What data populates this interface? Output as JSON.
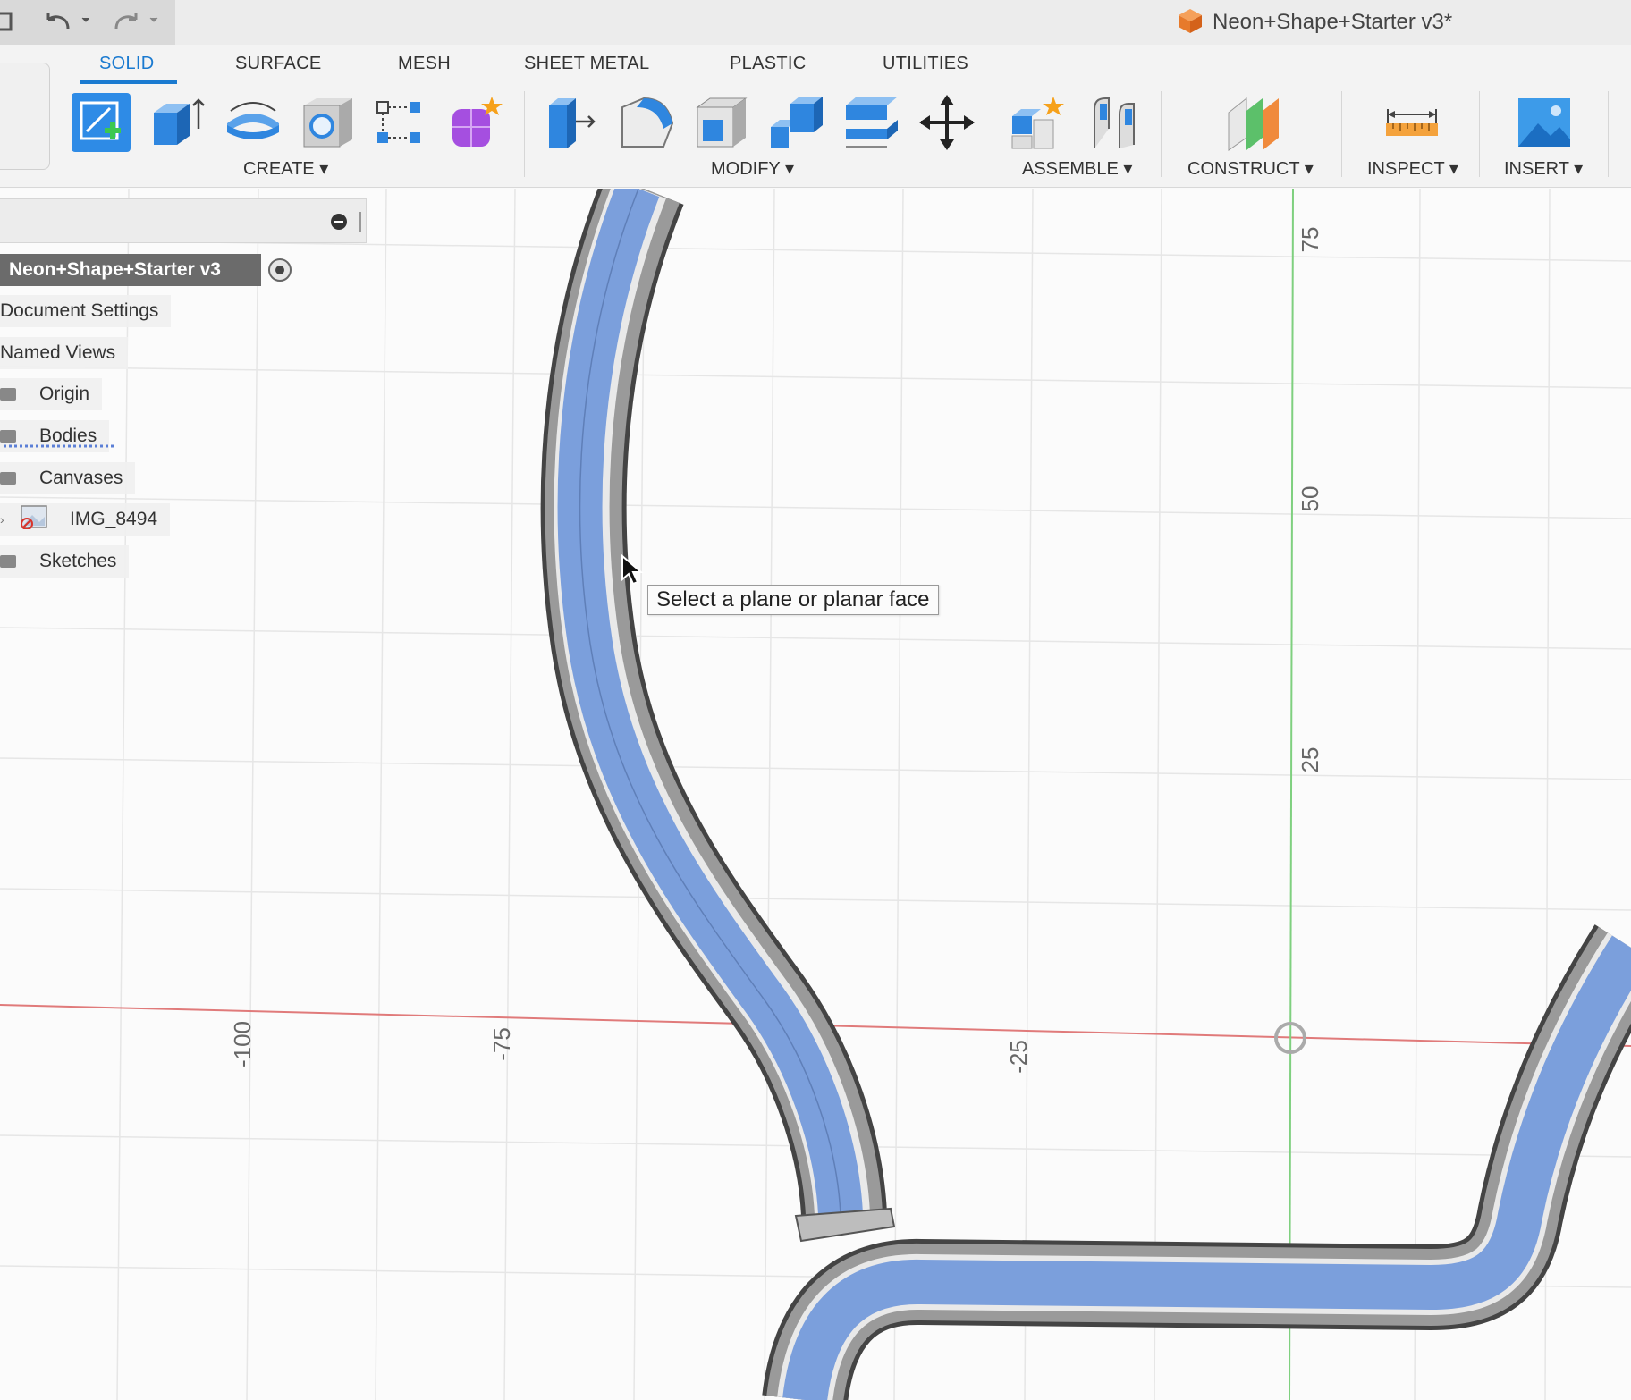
{
  "titlebar": {
    "document_title": "Neon+Shape+Starter v3*",
    "icons": [
      "save-icon",
      "undo-icon",
      "redo-icon",
      "app-cube-icon"
    ]
  },
  "tabs": [
    {
      "label": "SOLID",
      "active": true
    },
    {
      "label": "SURFACE",
      "active": false
    },
    {
      "label": "MESH",
      "active": false
    },
    {
      "label": "SHEET METAL",
      "active": false
    },
    {
      "label": "PLASTIC",
      "active": false
    },
    {
      "label": "UTILITIES",
      "active": false
    }
  ],
  "toolbar": {
    "groups": {
      "create": "CREATE ▾",
      "modify": "MODIFY ▾",
      "assemble": "ASSEMBLE ▾",
      "construct": "CONSTRUCT ▾",
      "inspect": "INSPECT ▾",
      "insert": "INSERT ▾"
    },
    "create_tools": [
      "create-sketch-icon",
      "extrude-icon",
      "revolve-icon",
      "hole-icon",
      "pattern-icon",
      "create-form-icon"
    ],
    "modify_tools": [
      "press-pull-icon",
      "fillet-icon",
      "shell-icon",
      "combine-icon",
      "offset-face-icon",
      "move-icon"
    ],
    "assemble_tools": [
      "new-component-icon",
      "joint-icon"
    ],
    "construct_tools": [
      "offset-plane-icon"
    ],
    "inspect_tools": [
      "measure-icon"
    ],
    "insert_tools": [
      "insert-image-icon"
    ]
  },
  "browser": {
    "root": "Neon+Shape+Starter v3",
    "items": [
      "Document Settings",
      "Named Views",
      "Origin",
      "Bodies",
      "Canvases",
      "IMG_8494",
      "Sketches"
    ]
  },
  "viewport": {
    "tooltip": "Select a plane or planar face",
    "axis_labels_x": [
      "-100",
      "-75",
      "-25"
    ],
    "axis_labels_y": [
      "75",
      "50",
      "25"
    ],
    "colors": {
      "accent": "#1a7ad0",
      "body_face": "#7b9fdc",
      "x_axis": "#e07a7a",
      "y_axis": "#7fd07f",
      "grid": "#e6e6e6"
    }
  }
}
